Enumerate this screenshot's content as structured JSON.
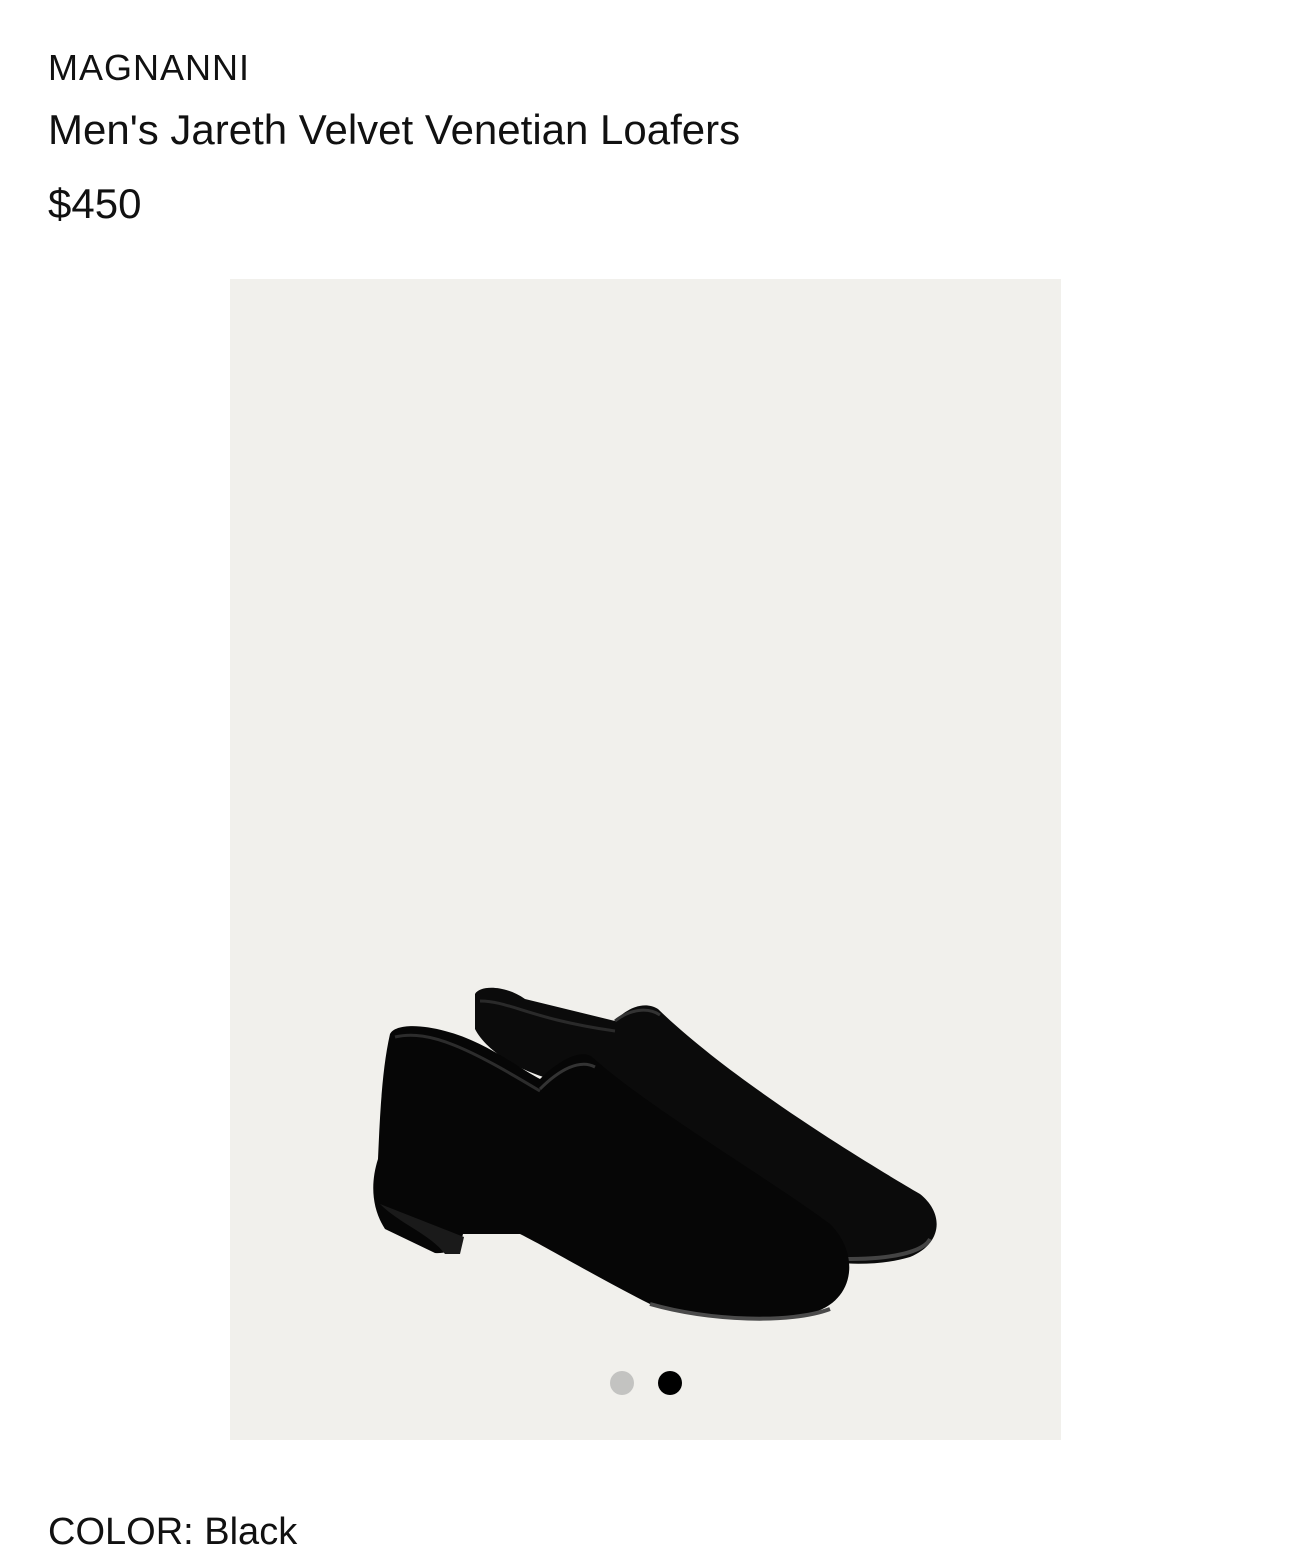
{
  "product": {
    "brand": "MAGNANNI",
    "name": "Men's Jareth Velvet Venetian Loafers",
    "price": "$450"
  },
  "gallery": {
    "image_subject": "black-velvet-loafers",
    "total_images": 2,
    "active_index": 2,
    "background_color": "#f1f0ec"
  },
  "color": {
    "label": "COLOR:",
    "value": "Black"
  }
}
